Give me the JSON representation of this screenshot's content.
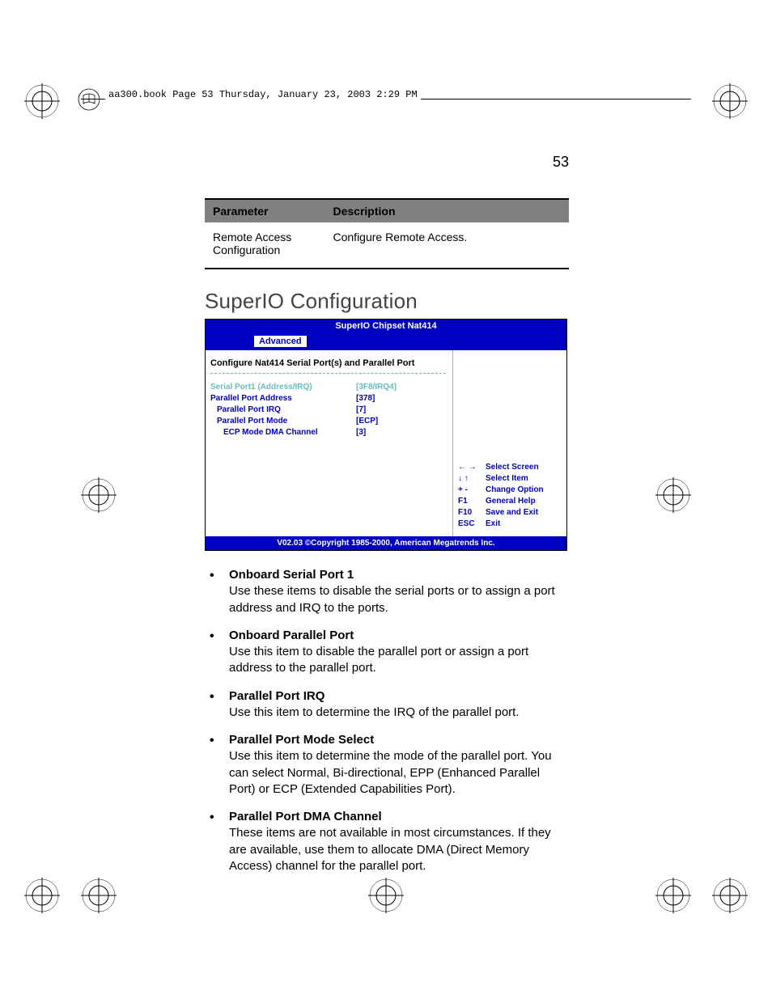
{
  "header": {
    "text": "aa300.book  Page 53  Thursday, January 23, 2003  2:29 PM"
  },
  "page_number": "53",
  "table": {
    "headers": {
      "param": "Parameter",
      "desc": "Description"
    },
    "rows": [
      {
        "param": "Remote Access Configuration",
        "desc": "Configure Remote Access."
      }
    ]
  },
  "section_heading": "SuperIO Configuration",
  "bios": {
    "title": "SuperIO Chipset Nat414",
    "tab": "Advanced",
    "left_heading": "Configure Nat414 Serial Port(s) and Parallel Port",
    "items": [
      {
        "label": "Serial Port1 (Address/IRQ)",
        "value": "[3F8/IRQ4]",
        "selected": true,
        "indent": 0
      },
      {
        "label": "Parallel Port Address",
        "value": "[378]",
        "selected": false,
        "indent": 0
      },
      {
        "label": "Parallel Port IRQ",
        "value": "[7]",
        "selected": false,
        "indent": 1
      },
      {
        "label": "Parallel Port Mode",
        "value": "[ECP]",
        "selected": false,
        "indent": 1
      },
      {
        "label": "ECP Mode DMA Channel",
        "value": "[3]",
        "selected": false,
        "indent": 2
      }
    ],
    "help": [
      {
        "key": "←  →",
        "label": "Select Screen"
      },
      {
        "key": "↓  ↑",
        "label": "Select Item"
      },
      {
        "key": "+ -",
        "label": "Change Option"
      },
      {
        "key": "F1",
        "label": "General Help"
      },
      {
        "key": "F10",
        "label": "Save and Exit"
      },
      {
        "key": "ESC",
        "label": "Exit"
      }
    ],
    "footer": "V02.03 ©Copyright 1985-2000, American Megatrends Inc."
  },
  "bullets": [
    {
      "title": "Onboard Serial Port 1",
      "body": "Use these items to disable the serial ports or to assign a port address and IRQ to the ports."
    },
    {
      "title": "Onboard Parallel Port",
      "body": "Use this item to disable the parallel port or assign a port address to the parallel port."
    },
    {
      "title": "Parallel Port IRQ",
      "body": "Use this item to determine the IRQ of the parallel port."
    },
    {
      "title": "Parallel Port Mode Select",
      "body": "Use this item to determine the mode of the parallel port. You can select Normal, Bi-directional, EPP (Enhanced Parallel Port) or ECP (Extended Capabilities Port)."
    },
    {
      "title": "Parallel Port DMA Channel",
      "body": "These items are not available in most circumstances. If they are available, use them to allocate DMA (Direct Memory Access) channel for the parallel port."
    }
  ]
}
